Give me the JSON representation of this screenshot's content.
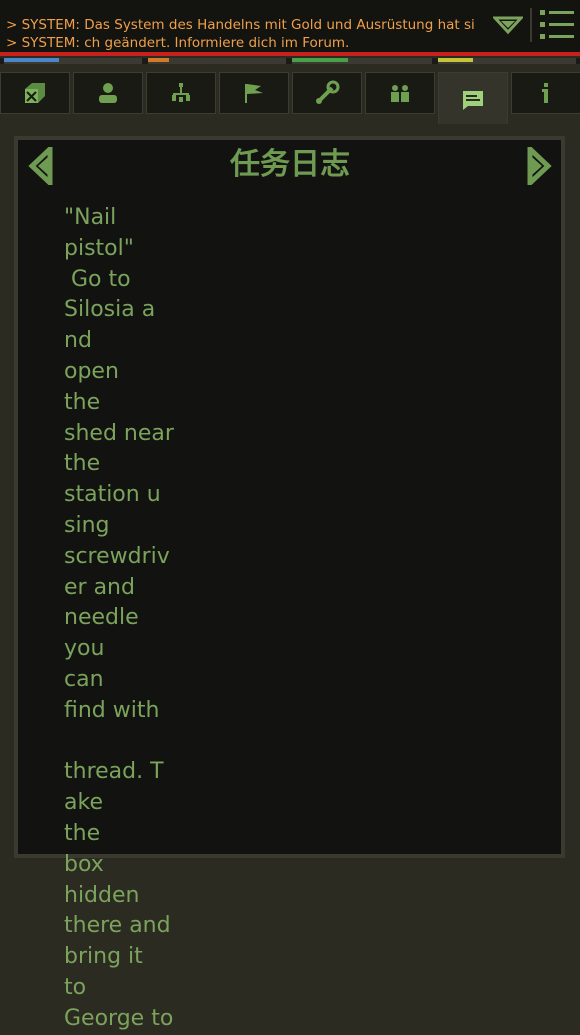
{
  "system_messages": [
    "> SYSTEM: Das System des Handelns mit Gold und Ausrüstung hat si",
    "> SYSTEM: ch geändert. Informiere dich im Forum."
  ],
  "stats": [
    {
      "color": "#4a86c8",
      "fraction": 0.4
    },
    {
      "color": "#d07a2a",
      "fraction": 0.15
    },
    {
      "color": "#4aa046",
      "fraction": 0.4
    },
    {
      "color": "#c8c43a",
      "fraction": 0.25
    }
  ],
  "tabs": [
    {
      "name": "inventory-icon"
    },
    {
      "name": "character-icon"
    },
    {
      "name": "skills-icon"
    },
    {
      "name": "map-flag-icon"
    },
    {
      "name": "craft-wrench-icon"
    },
    {
      "name": "group-icon"
    },
    {
      "name": "quest-log-icon",
      "active": true
    },
    {
      "name": "info-icon"
    }
  ],
  "panel": {
    "title": "任务日志",
    "quest_text": "\"Nail\npistol\"\n Go to\nSilosia a\nnd\nopen\nthe\nshed near\nthe\nstation u\nsing\nscrewdriv\ner and\nneedle\nyou\ncan\nfind with\n\nthread. T\nake\nthe\nbox\nhidden\nthere and\nbring it\nto\nGeorge to"
  },
  "colors": {
    "accent_green": "#7ba35c",
    "system_text": "#f0a04a",
    "alert_red": "#c8201c"
  }
}
